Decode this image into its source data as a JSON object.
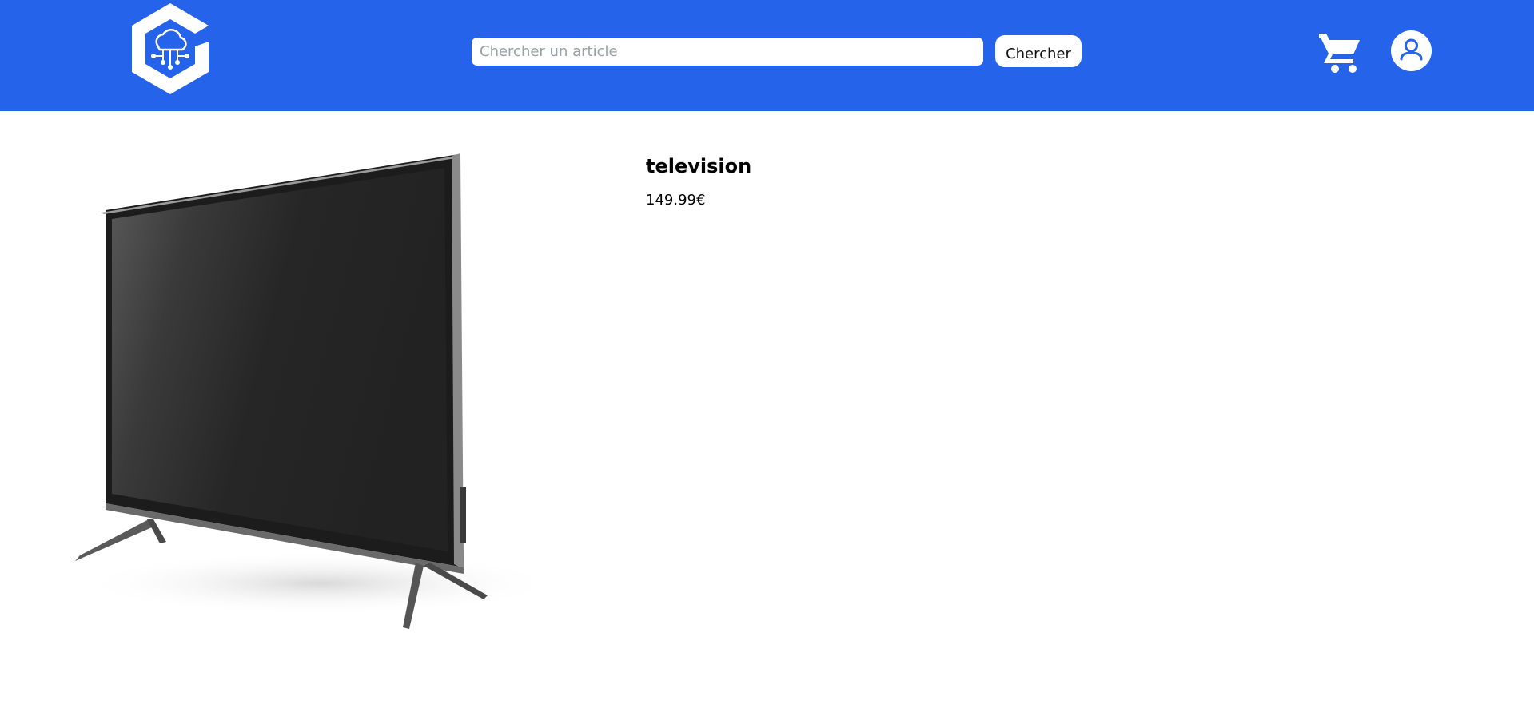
{
  "header": {
    "background_color": "#2563eb",
    "logo_icon": "cloud-network-hexagon-icon"
  },
  "search": {
    "placeholder": "Chercher un article",
    "value": "",
    "button_label": "Chercher"
  },
  "nav": {
    "cart_icon": "cart-icon",
    "account_icon": "user-icon"
  },
  "product": {
    "image_icon": "television-image",
    "title": "television",
    "price": "149.99€"
  }
}
